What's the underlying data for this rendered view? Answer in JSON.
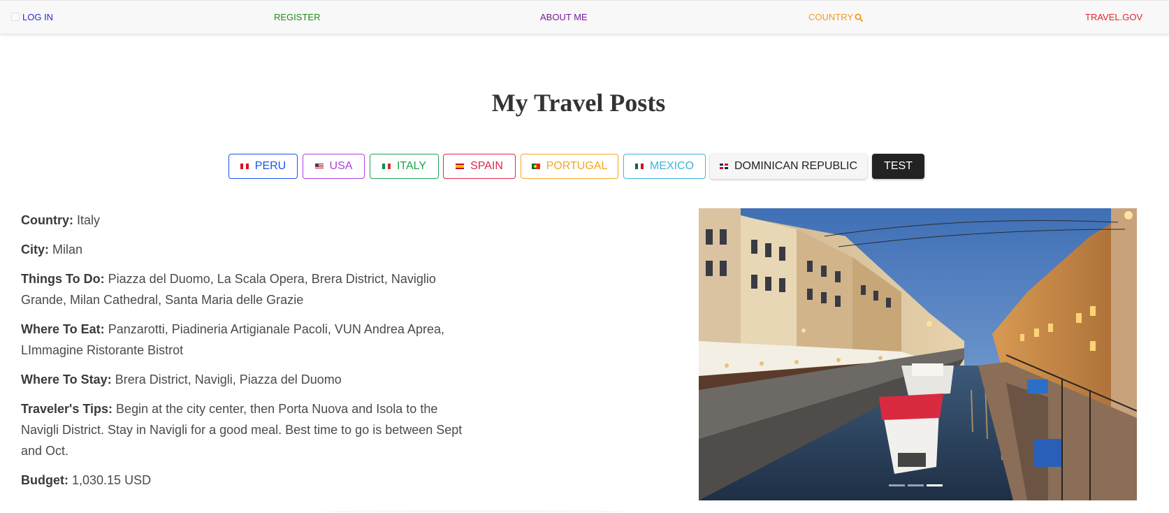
{
  "nav": {
    "login": "LOG IN",
    "register": "REGISTER",
    "about": "ABOUT ME",
    "country": "COUNTRY",
    "travel": "TRAVEL.GOV",
    "colors": {
      "login": "#2a2ae0",
      "register": "#1f8a1f",
      "about": "#7b1b9e",
      "country": "#f39a1e",
      "travel": "#e0262e"
    }
  },
  "title": "My Travel Posts",
  "filters": [
    {
      "label": "PERU",
      "flag": "peru-flag-icon",
      "color": "#1a56e8"
    },
    {
      "label": "USA",
      "flag": "usa-flag-icon",
      "color": "#b03ee0"
    },
    {
      "label": "ITALY",
      "flag": "italy-flag-icon",
      "color": "#1aa64b"
    },
    {
      "label": "SPAIN",
      "flag": "spain-flag-icon",
      "color": "#e0264a"
    },
    {
      "label": "PORTUGAL",
      "flag": "portugal-flag-icon",
      "color": "#f5a623"
    },
    {
      "label": "MEXICO",
      "flag": "mexico-flag-icon",
      "color": "#3bb7d8"
    },
    {
      "label": "DOMINICAN REPUBLIC",
      "flag": "dominican-republic-flag-icon",
      "color": "#222222"
    },
    {
      "label": "TEST",
      "color": "#222222"
    }
  ],
  "post": {
    "country": {
      "label": "Country:",
      "value": "Italy"
    },
    "city": {
      "label": "City:",
      "value": "Milan"
    },
    "things_to_do": {
      "label": "Things To Do:",
      "value": "Piazza del Duomo, La Scala Opera, Brera District, Naviglio Grande, Milan Cathedral, Santa Maria delle Grazie"
    },
    "where_to_eat": {
      "label": "Where To Eat:",
      "value": "Panzarotti, Piadineria Artigianale Pacoli, VUN Andrea Aprea, LImmagine Ristorante Bistrot"
    },
    "where_to_stay": {
      "label": "Where To Stay:",
      "value": "Brera District, Navigli, Piazza del Duomo"
    },
    "tips": {
      "label": "Traveler's Tips:",
      "value": "Begin at the city center, then Porta Nuova and Isola to the Navigli District. Stay in Navigli for a good meal. Best time to go is between Sept and Oct."
    },
    "budget": {
      "label": "Budget:",
      "value": "1,030.15 USD"
    }
  },
  "carousel": {
    "image": "milan-navigli-canal-photo",
    "slide_count": 3,
    "active_slide": 3
  }
}
